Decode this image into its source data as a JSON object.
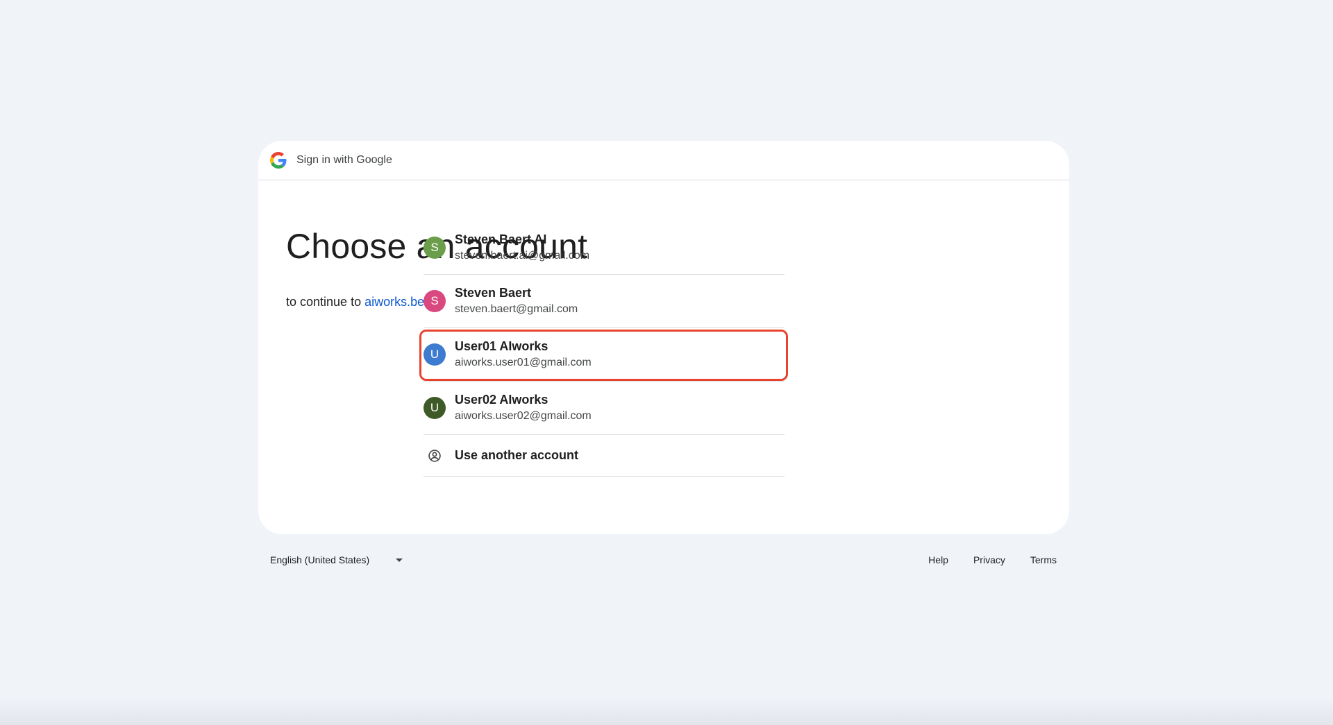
{
  "header": {
    "title": "Sign in with Google",
    "logo_icon": "google-g-icon"
  },
  "main": {
    "heading": "Choose an account",
    "subtitle_prefix": "to continue to",
    "site_link": "aiworks.be"
  },
  "accounts": [
    {
      "name": "Steven Baert AI",
      "email": "steven.baert.ai@gmail.com",
      "initial": "S",
      "color": "#6b9e4a"
    },
    {
      "name": "Steven Baert",
      "email": "steven.baert@gmail.com",
      "initial": "S",
      "color": "#d9487f"
    },
    {
      "name": "User01 AIworks",
      "email": "aiworks.user01@gmail.com",
      "initial": "U",
      "color": "#3d7bd0",
      "highlighted": true
    },
    {
      "name": "User02 AIworks",
      "email": "aiworks.user02@gmail.com",
      "initial": "U",
      "color": "#3e5a26"
    }
  ],
  "use_another": {
    "label": "Use another account",
    "icon": "person-circle-icon"
  },
  "footer": {
    "language": "English (United States)",
    "links": [
      "Help",
      "Privacy",
      "Terms"
    ]
  },
  "colors": {
    "background": "#f0f4f9",
    "link": "#0b57d0",
    "highlight": "#e8432e"
  }
}
